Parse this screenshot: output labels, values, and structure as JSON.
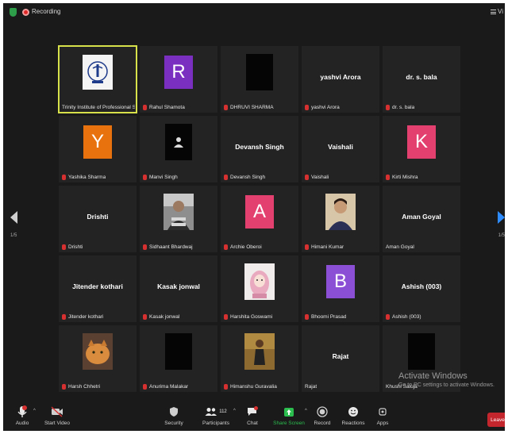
{
  "topbar": {
    "recording_label": "Recording",
    "view_label": "Vi"
  },
  "pager": {
    "left_label": "1/5",
    "right_label": "1/5"
  },
  "colors": {
    "active_border": "#d7e24a",
    "muted_mic": "#d63030",
    "leave_button": "#c4262e",
    "share_screen": "#2bbd4e",
    "next_page_arrow": "#2f8cff"
  },
  "participants": [
    {
      "name": "Trinity Institute of Professional St...",
      "kind": "logo",
      "muted": false,
      "active": true
    },
    {
      "name": "Rahul Shamota",
      "kind": "avatar",
      "initial": "R",
      "color": "#7a2fc1",
      "muted": true
    },
    {
      "name": "DHRUVI SHARMA",
      "kind": "black",
      "muted": true
    },
    {
      "name": "yashvi Arora",
      "kind": "text",
      "display": "yashvi Arora",
      "muted": true
    },
    {
      "name": "dr. s. bala",
      "kind": "text",
      "display": "dr. s. bala",
      "muted": true
    },
    {
      "name": "Yashika Sharma",
      "kind": "avatar",
      "initial": "Y",
      "color": "#e8720e",
      "muted": true
    },
    {
      "name": "Manvi Singh",
      "kind": "person-icon",
      "muted": true
    },
    {
      "name": "Devansh Singh",
      "kind": "text",
      "display": "Devansh Singh",
      "muted": true
    },
    {
      "name": "Vaishali",
      "kind": "text",
      "display": "Vaishali",
      "muted": true
    },
    {
      "name": "Kirti Mishra",
      "kind": "avatar",
      "initial": "K",
      "color": "#e3406f",
      "muted": true
    },
    {
      "name": "Drishti",
      "kind": "text",
      "display": "Drishti",
      "muted": true
    },
    {
      "name": "Sidhaant Bhardwaj",
      "kind": "photo",
      "muted": true
    },
    {
      "name": "Archie Oberoi",
      "kind": "avatar",
      "initial": "A",
      "color": "#e3406f",
      "muted": true
    },
    {
      "name": "Himani Kumar",
      "kind": "photo",
      "muted": true
    },
    {
      "name": "Aman Goyal",
      "kind": "text",
      "display": "Aman Goyal",
      "muted": false
    },
    {
      "name": "Jitender kothari",
      "kind": "text",
      "display": "Jitender kothari",
      "muted": true
    },
    {
      "name": "Kasak jonwal",
      "kind": "text",
      "display": "Kasak jonwal",
      "muted": true
    },
    {
      "name": "Harshita Goswami",
      "kind": "photo",
      "muted": true
    },
    {
      "name": "Bhoomi Prasad",
      "kind": "avatar",
      "initial": "B",
      "color": "#8b4fd6",
      "muted": true
    },
    {
      "name": "Ashish (003)",
      "kind": "text",
      "display": "Ashish (003)",
      "muted": true
    },
    {
      "name": "Harsh Chhetri",
      "kind": "photo",
      "muted": true
    },
    {
      "name": "Anurima Malakar",
      "kind": "black",
      "muted": true
    },
    {
      "name": "Himanshu Guravalia",
      "kind": "photo",
      "muted": true
    },
    {
      "name": "Rajat",
      "kind": "text",
      "display": "Rajat",
      "muted": false
    },
    {
      "name": "Khushi Saluja",
      "kind": "black",
      "muted": false
    }
  ],
  "watermark": {
    "title": "Activate Windows",
    "subtitle": "Go to PC settings to activate Windows."
  },
  "toolbar": {
    "audio": "Audio",
    "start_video": "Start Video",
    "security": "Security",
    "participants": "Participants",
    "participants_count": "112",
    "chat": "Chat",
    "share_screen": "Share Screen",
    "record": "Record",
    "reactions": "Reactions",
    "apps": "Apps",
    "leave": "Leave"
  }
}
